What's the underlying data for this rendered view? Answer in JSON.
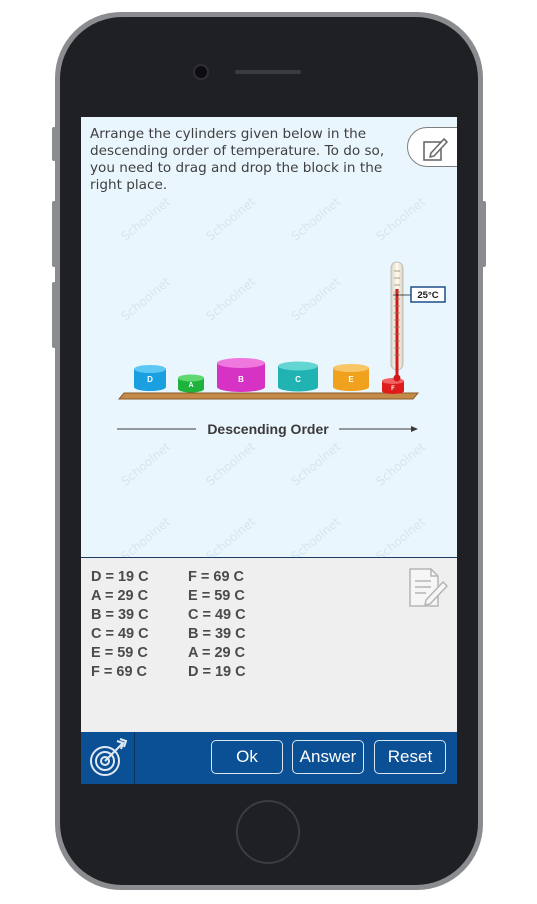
{
  "question": {
    "line1": "Arrange the cylinders given below in the",
    "line2": "descending order of temperature. To do so,",
    "line3": "you need to drag and drop the block in the",
    "line4": "right place."
  },
  "scene": {
    "order_label": "Descending Order",
    "thermometer_reading": "25°C",
    "cylinders": [
      {
        "label": "D",
        "color": "#1a9fe0"
      },
      {
        "label": "A",
        "color": "#1fb23d"
      },
      {
        "label": "B",
        "color": "#d632c3"
      },
      {
        "label": "C",
        "color": "#21b3b1"
      },
      {
        "label": "E",
        "color": "#f0a11e"
      },
      {
        "label": "F",
        "color": "#e01b1b"
      }
    ],
    "watermark": "Schoolnet"
  },
  "answers": {
    "left": [
      "D = 19 C",
      "A = 29 C",
      "B = 39 C",
      "C = 49 C",
      "E = 59 C",
      "F = 69 C"
    ],
    "right": [
      "F = 69 C",
      "E = 59 C",
      "C = 49 C",
      "B = 39 C",
      "A = 29 C",
      "D = 19 C"
    ]
  },
  "toolbar": {
    "ok_label": "Ok",
    "answer_label": "Answer",
    "reset_label": "Reset"
  },
  "icons": {
    "edit": "edit-note-icon",
    "answer_note": "note-pencil-icon",
    "target": "target-arrow-icon"
  },
  "colors": {
    "screen_bg": "#eaf6fe",
    "toolbar_bg": "#0b4f94",
    "answer_bg": "#efefef"
  }
}
